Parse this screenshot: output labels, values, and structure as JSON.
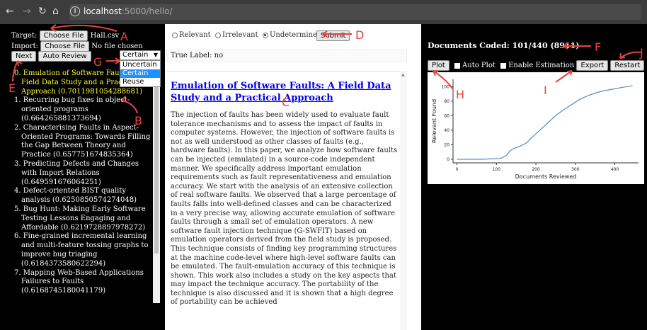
{
  "browser": {
    "url_host": "localhost",
    "url_path": ":5000/hello/",
    "back_icon": "arrow-left-icon",
    "forward_icon": "arrow-right-icon",
    "reload_icon": "reload-icon",
    "home_icon": "home-icon"
  },
  "left": {
    "target_label": "Target:",
    "target_button": "Choose File",
    "target_file": "Hall.csv",
    "import_label": "Import:",
    "import_button": "Choose File",
    "import_file": "No file chosen",
    "next_button": "Next",
    "auto_review_button": "Auto Review",
    "mode_select": "Certain",
    "mode_options": [
      "Uncertain",
      "Certain",
      "Reuse"
    ],
    "documents": [
      "0. Emulation of Software Faults: A Field Data Study and a Practical Approach (0.7011981054288681)",
      "1. Recurring bug fixes in object-oriented programs (0.664265881373694)",
      "2. Characterising Faults in Aspect-Oriented Programs: Towards Filling the Gap Between Theory and Practice (0.657751674835364)",
      "3. Predicting Defects and Changes with Import Relations (0.649591676064251)",
      "4. Defect-oriented BIST quality analysis (0.6250850574274048)",
      "5. Bug Hunt: Making Early Software Testing Lessons Engaging and Affordable (0.6219728897978272)",
      "6. Fine-grained incremental learning and multi-feature tossing graphs to improve bug triaging (0.6184373580622294)",
      "7. Mapping Web-Based Applications Failures to Faults (0.6168745180041179)"
    ]
  },
  "middle": {
    "radio_relevant": "Relevant",
    "radio_irrelevant": "Irrelevant",
    "radio_undetermined": "Undetermined",
    "submit_button": "Submit",
    "true_label": "True Label: no",
    "doc_title": "Emulation of Software Faults: A Field Data Study and a Practical Approach",
    "doc_abstract": "The injection of faults has been widely used to evaluate fault tolerance mechanisms and to assess the impact of faults in computer systems. However, the injection of software faults is not as well understood as other classes of faults (e.g., hardware faults). In this paper, we analyze how software faults can be injected (emulated) in a source-code independent manner. We specifically address important emulation requirements such as fault representativeness and emulation accuracy. We start with the analysis of an extensive collection of real software faults. We observed that a large percentage of faults falls into well-defined classes and can be characterized in a very precise way, allowing accurate emulation of software faults through a small set of emulation operators. A new software fault injection technique (G-SWFIT) based on emulation operators derived from the field study is proposed. This technique consists of finding key programming structures at the machine code-level where high-level software faults can be emulated. The fault-emulation accuracy of this technique is shown. This work also includes a study on the key aspects that may impact the technique accuracy. The portability of the technique is also discussed and it is shown that a high degree of portability can be achieved"
  },
  "right": {
    "coded_text": "Documents Coded: 101/440 (8911)",
    "plot_button": "Plot",
    "auto_plot_label": "Auto Plot",
    "enable_estimation_label": "Enable Estimation",
    "export_button": "Export",
    "restart_button": "Restart"
  },
  "chart_data": {
    "type": "line",
    "xlabel": "Documents Reviewed",
    "ylabel": "Relevant Found",
    "xticks": [
      0,
      100,
      200,
      300,
      400
    ],
    "yticks": [
      0,
      20,
      40,
      60,
      80,
      100
    ],
    "xlim": [
      -10,
      460
    ],
    "ylim": [
      -5,
      110
    ],
    "series": [
      {
        "x": [
          0,
          60,
          110,
          125,
          135,
          145,
          160,
          175,
          190,
          210,
          230,
          250,
          270,
          290,
          310,
          330,
          350,
          370,
          390,
          410,
          430,
          445
        ],
        "y": [
          0,
          0,
          1,
          5,
          12,
          15,
          18,
          22,
          30,
          40,
          50,
          60,
          68,
          75,
          82,
          87,
          91,
          94,
          96,
          98,
          100,
          101
        ],
        "color": "#4c8cc0"
      }
    ]
  },
  "annotations": [
    "A",
    "B",
    "C",
    "D",
    "E",
    "F",
    "G",
    "H",
    "I",
    "J"
  ]
}
